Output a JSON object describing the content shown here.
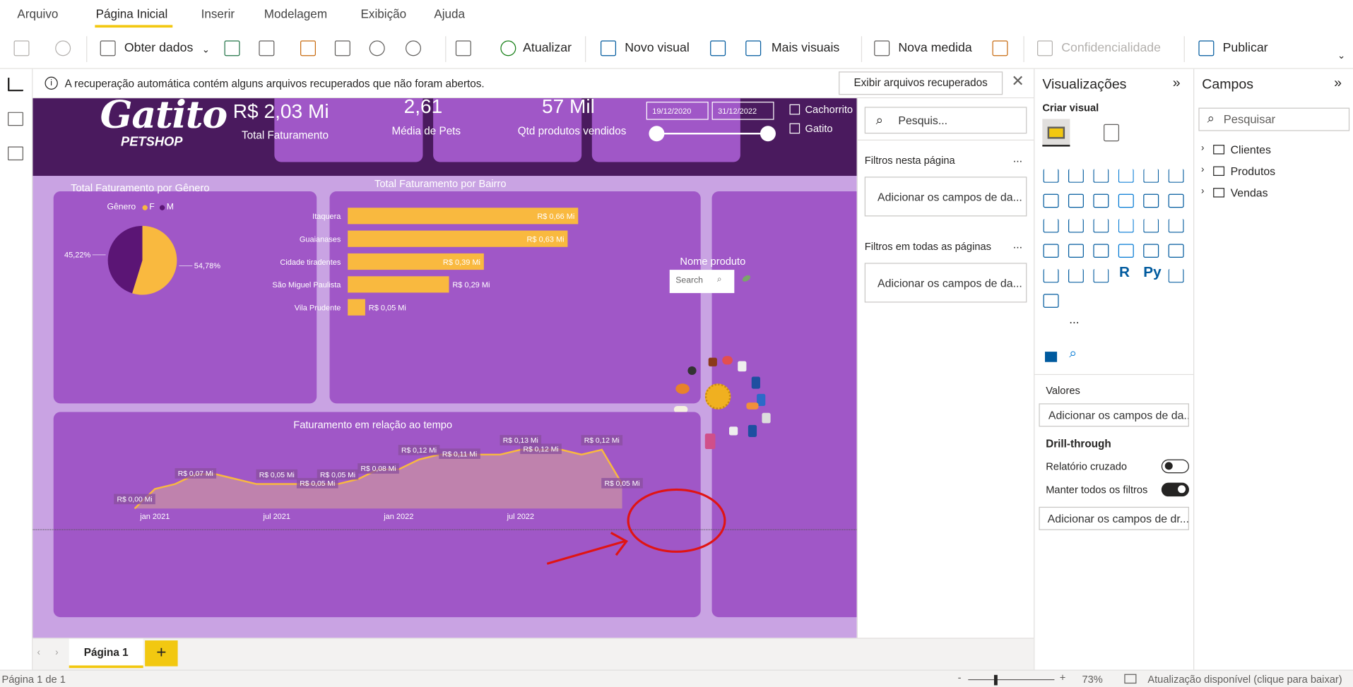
{
  "menu": {
    "items": [
      "Arquivo",
      "Página Inicial",
      "Inserir",
      "Modelagem",
      "Exibição",
      "Ajuda"
    ]
  },
  "toolbar": {
    "get_data": "Obter dados",
    "refresh": "Atualizar",
    "new_visual": "Novo visual",
    "more_visuals": "Mais visuais",
    "new_measure": "Nova medida",
    "sensitivity": "Confidencialidade",
    "publish": "Publicar"
  },
  "notice": {
    "text": "A recuperação automática contém alguns arquivos recuperados que não foram abertos.",
    "button": "Exibir arquivos recuperados"
  },
  "report": {
    "logo_main": "Gatito",
    "logo_sub": "PETSHOP",
    "kpis": [
      {
        "value": "R$ 2,03 Mi",
        "label": "Total Faturamento"
      },
      {
        "value": "2,61",
        "label": "Média de Pets"
      },
      {
        "value": "57 Mil",
        "label": "Qtd produtos vendidos"
      }
    ],
    "date_start": "19/12/2020",
    "date_end": "31/12/2022",
    "slicer_options": [
      "Cachorrito",
      "Gatito"
    ],
    "product_slicer": {
      "title": "Nome produto",
      "placeholder": "Search"
    },
    "colors": {
      "header": "#4a1a5e",
      "card": "#a057c7",
      "bg": "#c9a3e3",
      "accent": "#f9b93f",
      "dark": "#5b1575"
    }
  },
  "chart_data": [
    {
      "type": "pie",
      "title": "Total Faturamento por Gênero",
      "legend_title": "Gênero",
      "legend": [
        "F",
        "M"
      ],
      "values": [
        54.78,
        45.22
      ],
      "labels": [
        "54,78%",
        "45,22%"
      ],
      "colors": [
        "#f9b93f",
        "#5b1575"
      ]
    },
    {
      "type": "bar",
      "title": "Total Faturamento por Bairro",
      "categories": [
        "Itaquera",
        "Guaianases",
        "Cidade tiradentes",
        "São Miguel Paulista",
        "Vila Prudente"
      ],
      "values": [
        0.66,
        0.63,
        0.39,
        0.29,
        0.05
      ],
      "labels": [
        "R$ 0,66 Mi",
        "R$ 0,63 Mi",
        "R$ 0,39 Mi",
        "R$ 0,29 Mi",
        "R$ 0,05 Mi"
      ],
      "xlim": [
        0,
        0.66
      ],
      "unit": "R$ Mi"
    },
    {
      "type": "area",
      "title": "Faturamento em relação ao tempo",
      "x_ticks": [
        "jan 2021",
        "jul 2021",
        "jan 2022",
        "jul 2022"
      ],
      "x": [
        "2020-12",
        "2021-01",
        "2021-02",
        "2021-03",
        "2021-04",
        "2021-05",
        "2021-06",
        "2021-07",
        "2021-08",
        "2021-09",
        "2021-10",
        "2021-11",
        "2021-12",
        "2022-01",
        "2022-02",
        "2022-03",
        "2022-04",
        "2022-05",
        "2022-06",
        "2022-07",
        "2022-08",
        "2022-09",
        "2022-10",
        "2022-11",
        "2022-12"
      ],
      "values": [
        0.0,
        0.04,
        0.05,
        0.07,
        0.07,
        0.06,
        0.05,
        0.05,
        0.05,
        0.05,
        0.05,
        0.06,
        0.08,
        0.08,
        0.1,
        0.11,
        0.11,
        0.11,
        0.11,
        0.12,
        0.12,
        0.12,
        0.11,
        0.12,
        0.05
      ],
      "point_labels": [
        {
          "index": 0,
          "text": "R$ 0,00 Mi"
        },
        {
          "index": 3,
          "text": "R$ 0,07 Mi"
        },
        {
          "index": 7,
          "text": "R$ 0,05 Mi"
        },
        {
          "index": 9,
          "text": "R$ 0,05 Mi"
        },
        {
          "index": 10,
          "text": "R$ 0,05 Mi"
        },
        {
          "index": 12,
          "text": "R$ 0,08 Mi"
        },
        {
          "index": 14,
          "text": "R$ 0,12 Mi"
        },
        {
          "index": 16,
          "text": "R$ 0,11 Mi"
        },
        {
          "index": 19,
          "text": "R$ 0,13 Mi"
        },
        {
          "index": 20,
          "text": "R$ 0,12 Mi"
        },
        {
          "index": 23,
          "text": "R$ 0,12 Mi"
        },
        {
          "index": 24,
          "text": "R$ 0,05 Mi"
        }
      ],
      "ylim": [
        0,
        0.13
      ]
    }
  ],
  "filters": {
    "search_placeholder": "Pesquis...",
    "this_page": "Filtros nesta página",
    "all_pages": "Filtros em todas as páginas",
    "add_fields": "Adicionar os campos de da...",
    "more": "..."
  },
  "visualizations": {
    "title": "Visualizações",
    "build_visual": "Criar visual",
    "values_label": "Valores",
    "add_fields": "Adicionar os campos de da...",
    "drillthrough": "Drill-through",
    "cross_report": "Relatório cruzado",
    "keep_filters": "Manter todos os filtros",
    "add_drill": "Adicionar os campos de dr...",
    "cross_report_on": false,
    "keep_filters_on": true,
    "r_label": "R",
    "py_label": "Py",
    "more": "..."
  },
  "fields": {
    "title": "Campos",
    "search_placeholder": "Pesquisar",
    "tables": [
      "Clientes",
      "Produtos",
      "Vendas"
    ]
  },
  "pages": {
    "tab": "Página 1",
    "add": "+"
  },
  "status": {
    "page_info": "Página 1 de 1",
    "zoom": "73%",
    "update": "Atualização disponível (clique para baixar)",
    "minus": "-",
    "plus": "+"
  }
}
